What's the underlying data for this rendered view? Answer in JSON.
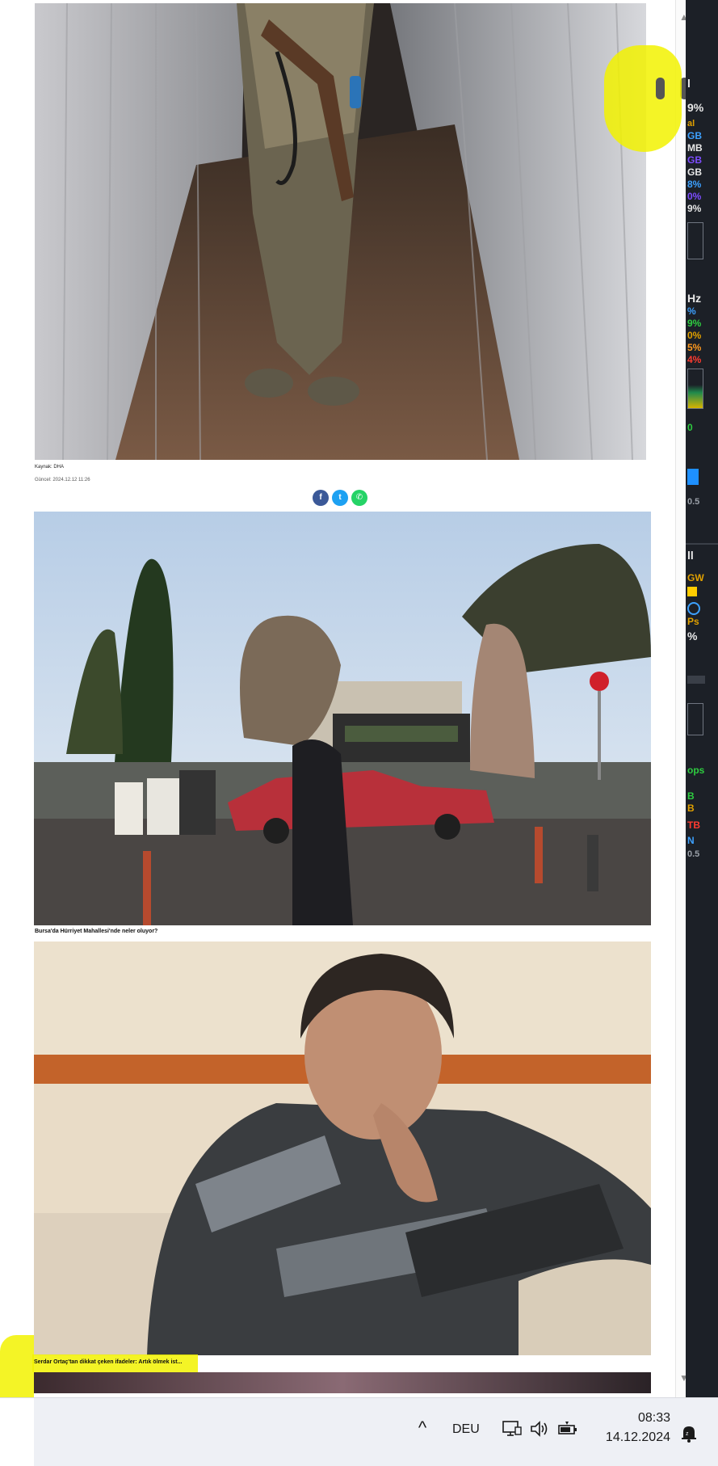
{
  "article": {
    "photo_source": "Kaynak: DHA",
    "updated": "Güncel: 2024.12.12 11:26",
    "share_buttons": [
      {
        "icon": "facebook-icon",
        "glyph": "f",
        "color": "#3b5998"
      },
      {
        "icon": "twitter-icon",
        "glyph": "t",
        "color": "#1da1f2"
      },
      {
        "icon": "whatsapp-icon",
        "glyph": "✆",
        "color": "#25d366"
      }
    ]
  },
  "related": [
    {
      "title": "Bursa'da Hürriyet Mahallesi'nde neler oluyor?"
    },
    {
      "title": "Serdar Ortaç'tan dikkat çeken ifadeler: Artık ölmek ist..."
    }
  ],
  "scrollbar": {
    "up_arrow": "▲",
    "down_arrow": "▼"
  },
  "side_panel": {
    "lines_top": [
      "l",
      "9%",
      "al",
      "GB",
      "MB",
      "GB",
      "GB",
      "8%",
      "0%",
      "9%"
    ],
    "lines_mid": [
      "Hz",
      "%",
      "9%",
      "0%",
      "5%",
      "4%"
    ],
    "value_a": "0",
    "value_b": "0.5",
    "lines_low": [
      "ll",
      "GW",
      "Ps",
      "%"
    ],
    "lines_bottom": [
      "ops",
      "B",
      "B",
      "TB",
      "N",
      "0.5"
    ]
  },
  "taskbar": {
    "chevron": "^",
    "language": "DEU",
    "time": "08:33",
    "date": "14.12.2024"
  },
  "colors": {
    "highlight": "#f2f200",
    "facebook": "#3b5998",
    "twitter": "#1da1f2",
    "whatsapp": "#25d366"
  }
}
